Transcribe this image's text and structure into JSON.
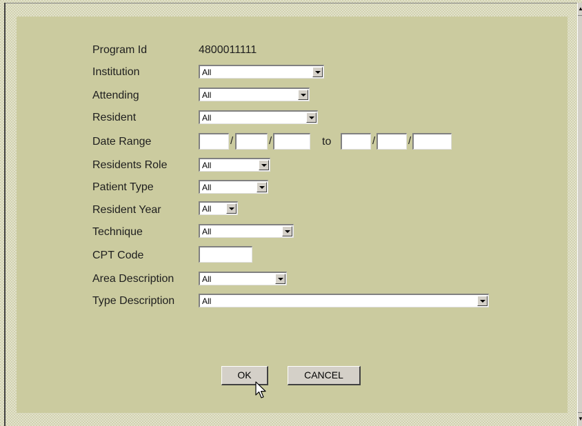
{
  "scrollbar": {
    "up_icon": "scroll-up-arrow-icon",
    "down_icon": "scroll-down-arrow-icon"
  },
  "form": {
    "program_id_label": "Program Id",
    "program_id_value": "4800011111",
    "institution_label": "Institution",
    "institution_value": "All",
    "attending_label": "Attending",
    "attending_value": "All",
    "resident_label": "Resident",
    "resident_value": "All",
    "date_range_label": "Date Range",
    "date_sep": "/",
    "date_to": "to",
    "date_from_month": "",
    "date_from_day": "",
    "date_from_year": "",
    "date_to_month": "",
    "date_to_day": "",
    "date_to_year": "",
    "residents_role_label": "Residents Role",
    "residents_role_value": "All",
    "patient_type_label": "Patient Type",
    "patient_type_value": "All",
    "resident_year_label": "Resident Year",
    "resident_year_value": "All",
    "technique_label": "Technique",
    "technique_value": "All",
    "cpt_code_label": "CPT Code",
    "cpt_code_value": "",
    "area_description_label": "Area Description",
    "area_description_value": "All",
    "type_description_label": "Type Description",
    "type_description_value": "All"
  },
  "buttons": {
    "ok_label": "OK",
    "cancel_label": "CANCEL"
  },
  "colors": {
    "panel": "#cbcb9f",
    "frame": "#d2d2b0",
    "button_face": "#d4d0c8"
  }
}
